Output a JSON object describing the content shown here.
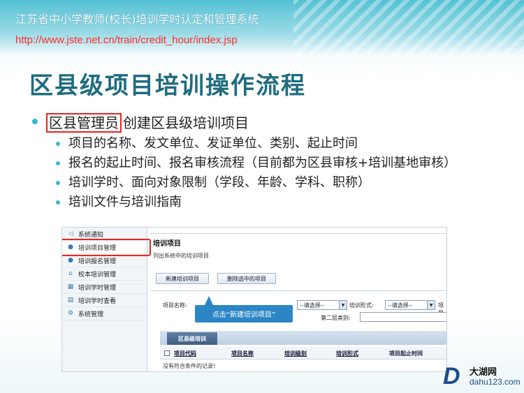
{
  "header": {
    "system_title": "江苏省中小学教师(校长)培训学时认定和管理系统",
    "url": "http://www.jste.net.cn/train/credit_hour/index.jsp"
  },
  "slide": {
    "title": "区县级项目培训操作流程",
    "bullet_main_highlight": "区县管理员",
    "bullet_main_rest": "创建区县级培训项目",
    "sub_bullets": [
      "项目的名称、发文单位、发证单位、类别、起止时间",
      "报名的起止时间、报名审核流程（目前都为区县审核+培训基地审核）",
      "培训学时、面向对象限制（学段、年龄、学科、职称）",
      "培训文件与培训指南"
    ]
  },
  "screenshot": {
    "nav_items": [
      {
        "label": "系统通知",
        "icon": "megaphone-icon"
      },
      {
        "label": "培训项目管理",
        "icon": "people-icon"
      },
      {
        "label": "培训报名管理",
        "icon": "people-group-icon"
      },
      {
        "label": "校本培训管理",
        "icon": "school-icon"
      },
      {
        "label": "培训学时管理",
        "icon": "grid-icon"
      },
      {
        "label": "培训学时查看",
        "icon": "document-icon"
      },
      {
        "label": "系统管理",
        "icon": "gear-icon"
      }
    ],
    "panel_title": "培训项目",
    "panel_subtitle": "列出系统中的培训项目",
    "btn_new": "新建培训项目",
    "btn_delete": "删除选中的项目",
    "label_project_name": "项目名称:",
    "select_1": "--请选择--",
    "label_training_form": "培训形式:",
    "select_2": "--请选择--",
    "label_project_clip": "项目",
    "label_category2": "第二层类别:",
    "callout": "点击“新建培训项目”",
    "tab_label": "区县级培训",
    "columns": [
      "项目代码",
      "项目名称",
      "培训级别",
      "培训形式",
      "项目起止时间"
    ],
    "empty_text": "没有符合条件的记录!"
  },
  "watermark": {
    "letter": "D",
    "name": "大湖网",
    "url": "dahu123.com"
  },
  "colors": {
    "accent": "#3cb7cc",
    "title": "#1f6c7f",
    "url": "#ff2a2a",
    "highlight_border": "#ee2222",
    "callout": "#2c86c6"
  }
}
